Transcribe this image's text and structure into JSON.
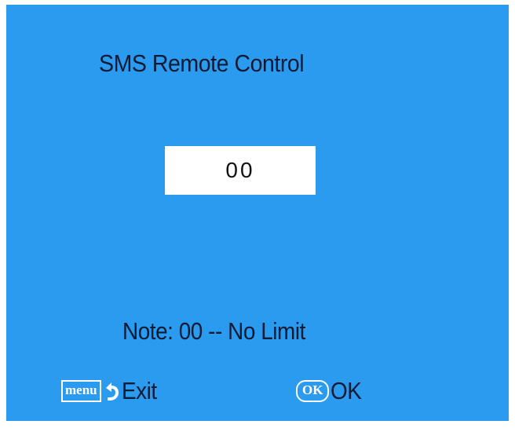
{
  "screen": {
    "background_color": "#2b9bf0",
    "title": "SMS Remote Control",
    "value": "00",
    "note": "Note: 00 -- No Limit"
  },
  "footer": {
    "menu_key": "menu",
    "menu_icon": "back-arrow-icon",
    "exit_label": "Exit",
    "ok_key": "OK",
    "ok_label": "OK"
  }
}
